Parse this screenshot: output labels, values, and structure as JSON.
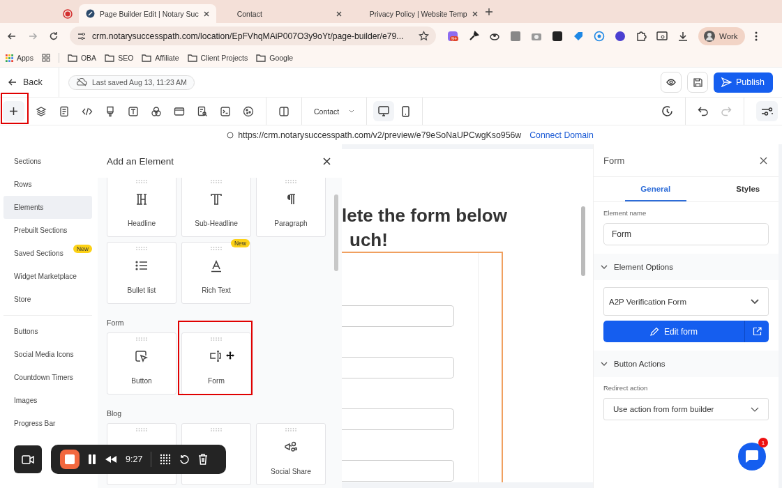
{
  "browser": {
    "tabs": [
      {
        "kind": "recording",
        "selected": false
      },
      {
        "kind": "page",
        "title": "Page Builder Edit | Notary Suc",
        "selected": true
      },
      {
        "kind": "page",
        "title": "Contact",
        "selected": false
      },
      {
        "kind": "page",
        "title": "Privacy Policy | Website Temp",
        "selected": false
      }
    ],
    "address": "crm.notarysuccesspath.com/location/EpFVhqMAiP007O3y9oYt/page-builder/e79...",
    "extension_badge": "9+",
    "profile": "Work",
    "bookmarks": [
      "Apps",
      "OBA",
      "SEO",
      "Affiliate",
      "Client Projects",
      "Google"
    ]
  },
  "header": {
    "back": "Back",
    "last_saved": "Last saved Aug 13, 11:23 AM",
    "publish": "Publish"
  },
  "toolbar": {
    "add_highlighted": true,
    "page_select": "Contact",
    "devices": [
      {
        "kind": "desktop",
        "selected": true
      },
      {
        "kind": "mobile",
        "selected": false
      }
    ],
    "redo_disabled": true
  },
  "preview": {
    "url": "https://crm.notarysuccesspath.com/v2/preview/e79eSoNaUPCwgKso956w",
    "connect": "Connect Domain"
  },
  "left_nav": {
    "groups": [
      [
        {
          "label": "Sections",
          "selected": false
        },
        {
          "label": "Rows",
          "selected": false
        },
        {
          "label": "Elements",
          "selected": true
        },
        {
          "label": "Prebuilt Sections",
          "selected": false
        },
        {
          "label": "Saved Sections",
          "selected": false,
          "badge": "New"
        },
        {
          "label": "Widget Marketplace",
          "selected": false
        },
        {
          "label": "Store",
          "selected": false
        }
      ],
      [
        {
          "label": "Buttons",
          "selected": false
        },
        {
          "label": "Social Media Icons",
          "selected": false
        },
        {
          "label": "Countdown Timers",
          "selected": false
        },
        {
          "label": "Images",
          "selected": false
        },
        {
          "label": "Progress Bar",
          "selected": false
        }
      ]
    ]
  },
  "add_panel": {
    "title": "Add an Element",
    "sections": [
      {
        "items": [
          {
            "kind": "headline",
            "label": "Headline",
            "highlighted": false
          },
          {
            "kind": "subheadline",
            "label": "Sub-Headline",
            "highlighted": false
          },
          {
            "kind": "paragraph",
            "label": "Paragraph",
            "highlighted": false
          },
          {
            "kind": "bullets",
            "label": "Bullet list",
            "highlighted": false
          },
          {
            "kind": "richtext",
            "label": "Rich Text",
            "badge": "New",
            "highlighted": false
          }
        ]
      },
      {
        "heading": "Form",
        "items": [
          {
            "kind": "button",
            "label": "Button",
            "highlighted": false
          },
          {
            "kind": "form",
            "label": "Form",
            "highlighted": true
          }
        ]
      },
      {
        "heading": "Blog",
        "items": [
          {
            "kind": "covered",
            "highlighted": false
          },
          {
            "kind": "covered",
            "highlighted": false
          },
          {
            "kind": "share",
            "label": "Social Share",
            "highlighted": false
          }
        ]
      }
    ]
  },
  "canvas": {
    "heading_lines": [
      "lete the form below",
      "uch!"
    ],
    "fields": [
      {
        "kind": "input"
      },
      {
        "kind": "input"
      },
      {
        "kind": "input"
      },
      {
        "kind": "input"
      }
    ]
  },
  "settings": {
    "title": "Form",
    "tabs": [
      {
        "label": "General",
        "selected": true
      },
      {
        "label": "Styles",
        "selected": false
      }
    ],
    "element_name_label": "Element name",
    "element_name": "Form",
    "sections": [
      {
        "title": "Element Options",
        "expanded": true,
        "select": "A2P Verification Form",
        "button": "Edit form"
      },
      {
        "title": "Button Actions",
        "expanded": true,
        "field_label": "Redirect action",
        "select": "Use action from form builder"
      }
    ],
    "chat_badge": "1"
  },
  "recorder": {
    "time": "9:27"
  }
}
